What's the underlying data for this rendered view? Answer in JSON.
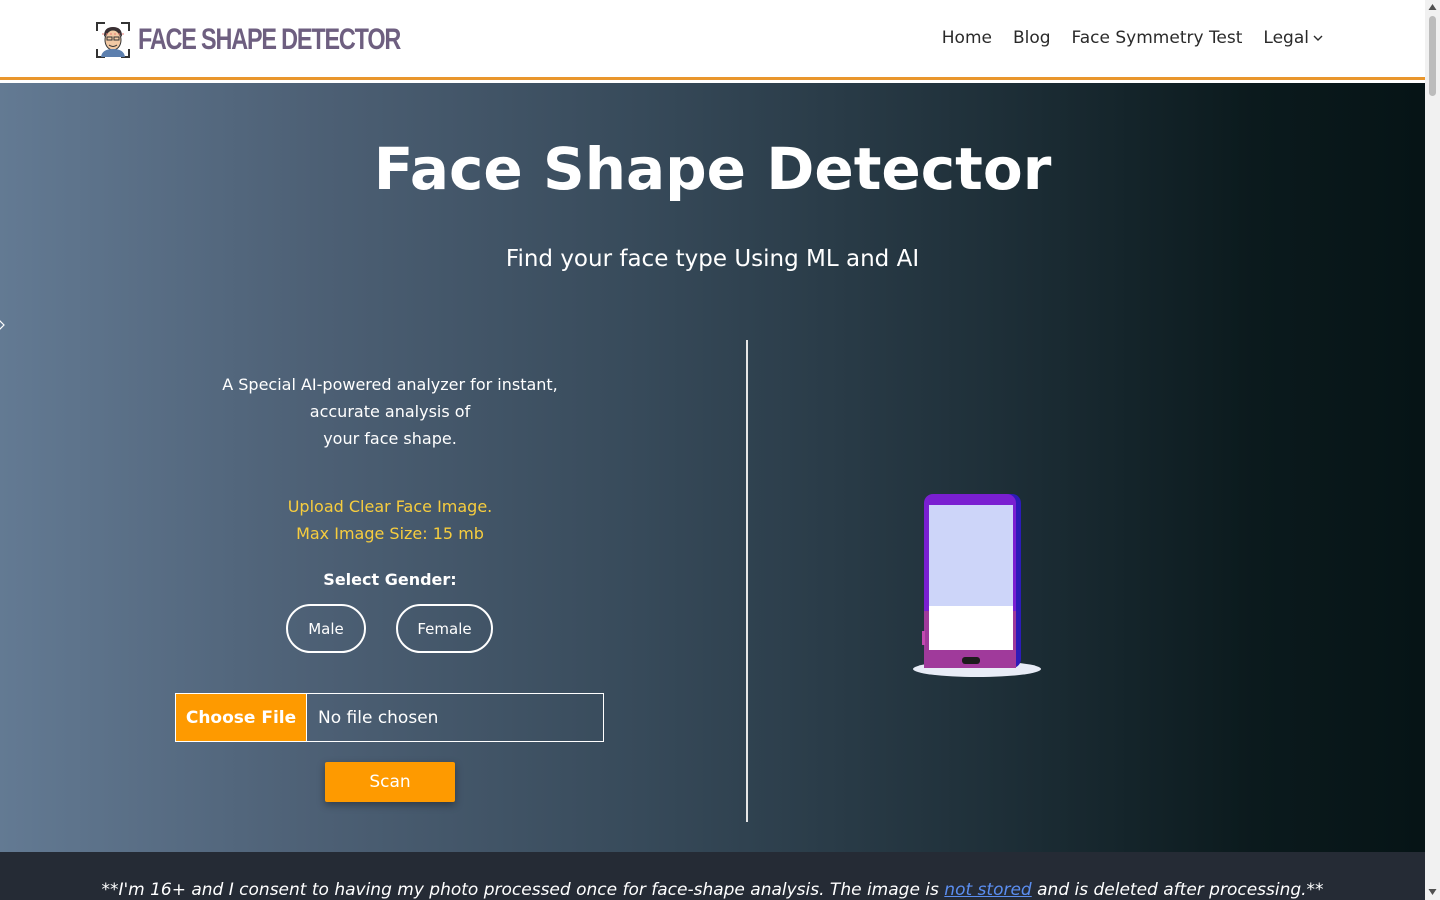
{
  "header": {
    "logo_text": "FACE SHAPE DETECTOR",
    "nav": {
      "home": "Home",
      "blog": "Blog",
      "symmetry": "Face Symmetry Test",
      "legal": "Legal"
    },
    "accent_color": "#e9962c"
  },
  "hero": {
    "title": "Face Shape Detector",
    "subtitle": "Find your face type Using ML and AI",
    "description": {
      "line1": "A Special AI-powered analyzer for instant,",
      "line2": "accurate analysis of",
      "line3": "your face shape."
    },
    "upload_note": {
      "line1": "Upload Clear Face Image.",
      "line2": "Max Image Size: 15 mb"
    },
    "gender_label": "Select Gender:",
    "gender_options": {
      "male": "Male",
      "female": "Female"
    },
    "file_input": {
      "button": "Choose File",
      "status": "No file chosen"
    },
    "scan_button": "Scan",
    "button_color": "#fe9a00",
    "note_color": "#f7cd3e"
  },
  "consent": {
    "prefix": "**I'm 16+ and I consent to having my photo processed once for face-shape analysis. The image is ",
    "link": "not stored",
    "suffix": " and is deleted after processing.**"
  }
}
